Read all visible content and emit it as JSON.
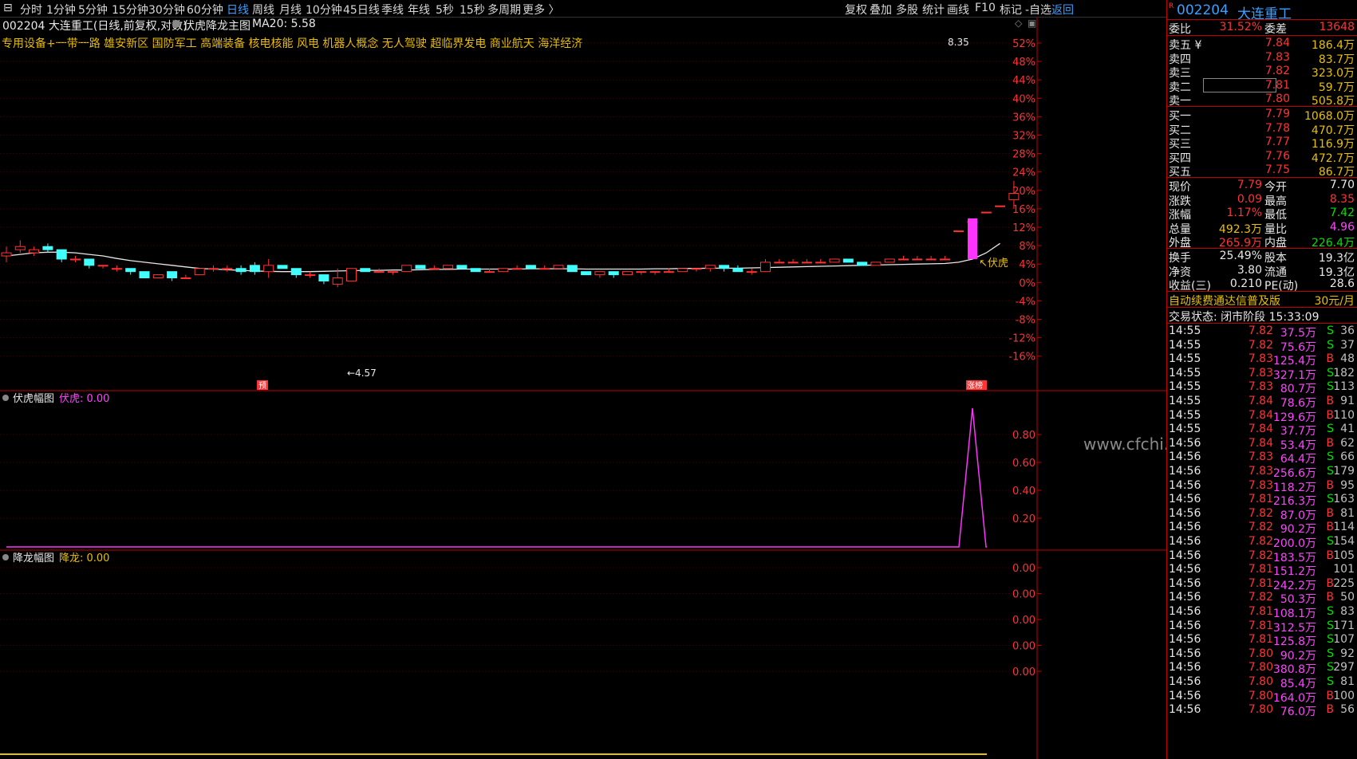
{
  "toolbar": {
    "periods": [
      "分时",
      "1分钟",
      "5分钟",
      "15分钟",
      "30分钟",
      "60分钟",
      "日线",
      "周线",
      "月线",
      "10分钟",
      "45日线",
      "季线",
      "年线",
      "5秒",
      "15秒",
      "多周期",
      "更多 〉"
    ],
    "active_period": "日线",
    "right_items": [
      "复权",
      "叠加",
      "多股",
      "统计",
      "画线",
      "F10",
      "标记",
      "-自选",
      "返回"
    ]
  },
  "header": {
    "stock": "002204 大连重工(日线,前复权,对数)",
    "indicator_name": "伏虎降龙主图",
    "ma_label": "MA20: 5.58"
  },
  "concepts": "专用设备+一带一路 雄安新区 国防军工 高端装备 核电核能 风电 机器人概念 无人驾驶 超临界发电 商业航天 海洋经济",
  "main_chart": {
    "y_axis_pct": [
      "52%",
      "48%",
      "44%",
      "40%",
      "36%",
      "32%",
      "28%",
      "24%",
      "20%",
      "16%",
      "12%",
      "8%",
      "4%",
      "0%",
      "-4%",
      "-8%",
      "-12%",
      "-16%"
    ],
    "high_label": "8.35",
    "low_label": "←4.57",
    "signal_label": "↖伏虎",
    "marker_left": "预",
    "marker_right": "涨榜",
    "colors": {
      "up": "#ff3333",
      "down": "#40ffff",
      "ma": "#e8e8e8",
      "signal": "#ff33ff"
    }
  },
  "panel2": {
    "title": "伏虎幅图",
    "value_label": "伏虎: 0.00",
    "y_axis": [
      "0.80",
      "0.60",
      "0.40",
      "0.20"
    ],
    "peak_value": 1.0
  },
  "panel3": {
    "title": "降龙幅图",
    "value_label": "降龙: 0.00",
    "y_axis": [
      "0.00",
      "0.00",
      "0.00",
      "0.00",
      "0.00"
    ]
  },
  "watermark": "www.cfchi.com",
  "quote": {
    "code": "002204",
    "name": "大连重工",
    "weibi_label": "委比",
    "weibi": "31.52%",
    "weicha_label": "委差",
    "weicha": "13648",
    "sell": [
      {
        "label": "卖五 ¥",
        "price": "7.84",
        "vol": "186.4万"
      },
      {
        "label": "卖四",
        "price": "7.83",
        "vol": "83.7万"
      },
      {
        "label": "卖三",
        "price": "7.82",
        "vol": "323.0万"
      },
      {
        "label": "卖二",
        "price": "7.81",
        "vol": "59.7万"
      },
      {
        "label": "卖一",
        "price": "7.80",
        "vol": "505.8万"
      }
    ],
    "buy": [
      {
        "label": "买一",
        "price": "7.79",
        "vol": "1068.0万"
      },
      {
        "label": "买二",
        "price": "7.78",
        "vol": "470.7万"
      },
      {
        "label": "买三",
        "price": "7.77",
        "vol": "116.9万"
      },
      {
        "label": "买四",
        "price": "7.76",
        "vol": "472.7万"
      },
      {
        "label": "买五",
        "price": "7.75",
        "vol": "86.7万"
      }
    ],
    "stats": [
      {
        "l1": "现价",
        "v1": "7.79",
        "c1": "red",
        "l2": "今开",
        "v2": "7.70",
        "c2": "white"
      },
      {
        "l1": "涨跌",
        "v1": "0.09",
        "c1": "red",
        "l2": "最高",
        "v2": "8.35",
        "c2": "red"
      },
      {
        "l1": "涨幅",
        "v1": "1.17%",
        "c1": "red",
        "l2": "最低",
        "v2": "7.42",
        "c2": "green"
      },
      {
        "l1": "总量",
        "v1": "492.3万",
        "c1": "yellow",
        "l2": "量比",
        "v2": "4.96",
        "c2": "magenta"
      },
      {
        "l1": "外盘",
        "v1": "265.9万",
        "c1": "red",
        "l2": "内盘",
        "v2": "226.4万",
        "c2": "green"
      }
    ],
    "stats2": [
      {
        "l1": "换手",
        "v1": "25.49%",
        "l2": "股本",
        "v2": "19.3亿"
      },
      {
        "l1": "净资",
        "v1": "3.80",
        "l2": "流通",
        "v2": "19.3亿"
      },
      {
        "l1": "收益(三)",
        "v1": "0.210",
        "l2": "PE(动)",
        "v2": "28.6"
      }
    ],
    "promo": "自动续费通达信普及版",
    "promo_price": "30元/月",
    "trade_status": "交易状态: 闭市阶段 15:33:09"
  },
  "ticks": [
    {
      "t": "14:55",
      "p": "7.82",
      "v": "37.5万",
      "s": "S",
      "n": "36"
    },
    {
      "t": "14:55",
      "p": "7.82",
      "v": "75.6万",
      "s": "S",
      "n": "37"
    },
    {
      "t": "14:55",
      "p": "7.83",
      "v": "125.4万",
      "s": "B",
      "n": "48"
    },
    {
      "t": "14:55",
      "p": "7.83",
      "v": "327.1万",
      "s": "S",
      "n": "182"
    },
    {
      "t": "14:55",
      "p": "7.83",
      "v": "80.7万",
      "s": "S",
      "n": "113"
    },
    {
      "t": "14:55",
      "p": "7.84",
      "v": "78.6万",
      "s": "B",
      "n": "91"
    },
    {
      "t": "14:55",
      "p": "7.84",
      "v": "129.6万",
      "s": "B",
      "n": "110"
    },
    {
      "t": "14:55",
      "p": "7.84",
      "v": "37.7万",
      "s": "S",
      "n": "41"
    },
    {
      "t": "14:56",
      "p": "7.84",
      "v": "53.4万",
      "s": "B",
      "n": "62"
    },
    {
      "t": "14:56",
      "p": "7.83",
      "v": "64.4万",
      "s": "S",
      "n": "66"
    },
    {
      "t": "14:56",
      "p": "7.83",
      "v": "256.6万",
      "s": "S",
      "n": "179"
    },
    {
      "t": "14:56",
      "p": "7.83",
      "v": "118.2万",
      "s": "B",
      "n": "95"
    },
    {
      "t": "14:56",
      "p": "7.81",
      "v": "216.3万",
      "s": "S",
      "n": "163"
    },
    {
      "t": "14:56",
      "p": "7.82",
      "v": "87.0万",
      "s": "B",
      "n": "81"
    },
    {
      "t": "14:56",
      "p": "7.82",
      "v": "90.2万",
      "s": "B",
      "n": "114"
    },
    {
      "t": "14:56",
      "p": "7.82",
      "v": "200.0万",
      "s": "S",
      "n": "154"
    },
    {
      "t": "14:56",
      "p": "7.82",
      "v": "183.5万",
      "s": "B",
      "n": "105"
    },
    {
      "t": "14:56",
      "p": "7.81",
      "v": "151.2万",
      "s": "",
      "n": "101"
    },
    {
      "t": "14:56",
      "p": "7.81",
      "v": "242.2万",
      "s": "B",
      "n": "225"
    },
    {
      "t": "14:56",
      "p": "7.82",
      "v": "50.3万",
      "s": "B",
      "n": "50"
    },
    {
      "t": "14:56",
      "p": "7.81",
      "v": "108.1万",
      "s": "S",
      "n": "83"
    },
    {
      "t": "14:56",
      "p": "7.81",
      "v": "312.5万",
      "s": "S",
      "n": "171"
    },
    {
      "t": "14:56",
      "p": "7.81",
      "v": "125.8万",
      "s": "S",
      "n": "107"
    },
    {
      "t": "14:56",
      "p": "7.80",
      "v": "90.2万",
      "s": "S",
      "n": "92"
    },
    {
      "t": "14:56",
      "p": "7.80",
      "v": "380.8万",
      "s": "S",
      "n": "297"
    },
    {
      "t": "14:56",
      "p": "7.80",
      "v": "85.4万",
      "s": "S",
      "n": "81"
    },
    {
      "t": "14:56",
      "p": "7.80",
      "v": "164.0万",
      "s": "B",
      "n": "100"
    },
    {
      "t": "14:56",
      "p": "7.80",
      "v": "76.0万",
      "s": "B",
      "n": "56"
    }
  ],
  "candles": [
    {
      "o": 0.32,
      "c": 0.33,
      "h": 0.35,
      "l": 0.3
    },
    {
      "o": 0.34,
      "c": 0.35,
      "h": 0.37,
      "l": 0.33
    },
    {
      "o": 0.33,
      "c": 0.34,
      "h": 0.35,
      "l": 0.32
    },
    {
      "o": 0.35,
      "c": 0.34,
      "h": 0.36,
      "l": 0.33
    },
    {
      "o": 0.34,
      "c": 0.31,
      "h": 0.34,
      "l": 0.3
    },
    {
      "o": 0.31,
      "c": 0.31,
      "h": 0.32,
      "l": 0.3
    },
    {
      "o": 0.31,
      "c": 0.29,
      "h": 0.31,
      "l": 0.28
    },
    {
      "o": 0.29,
      "c": 0.29,
      "h": 0.29,
      "l": 0.28
    },
    {
      "o": 0.28,
      "c": 0.28,
      "h": 0.29,
      "l": 0.27
    },
    {
      "o": 0.28,
      "c": 0.27,
      "h": 0.28,
      "l": 0.26
    },
    {
      "o": 0.27,
      "c": 0.25,
      "h": 0.27,
      "l": 0.25
    },
    {
      "o": 0.25,
      "c": 0.26,
      "h": 0.26,
      "l": 0.25
    },
    {
      "o": 0.27,
      "c": 0.25,
      "h": 0.27,
      "l": 0.24
    },
    {
      "o": 0.25,
      "c": 0.25,
      "h": 0.26,
      "l": 0.25
    },
    {
      "o": 0.26,
      "c": 0.28,
      "h": 0.28,
      "l": 0.26
    },
    {
      "o": 0.28,
      "c": 0.28,
      "h": 0.29,
      "l": 0.27
    },
    {
      "o": 0.28,
      "c": 0.28,
      "h": 0.29,
      "l": 0.27
    },
    {
      "o": 0.28,
      "c": 0.27,
      "h": 0.29,
      "l": 0.26
    },
    {
      "o": 0.29,
      "c": 0.27,
      "h": 0.3,
      "l": 0.26
    },
    {
      "o": 0.27,
      "c": 0.29,
      "h": 0.31,
      "l": 0.25
    },
    {
      "o": 0.29,
      "c": 0.28,
      "h": 0.29,
      "l": 0.28
    },
    {
      "o": 0.28,
      "c": 0.26,
      "h": 0.28,
      "l": 0.25
    },
    {
      "o": 0.26,
      "c": 0.26,
      "h": 0.27,
      "l": 0.25
    },
    {
      "o": 0.26,
      "c": 0.24,
      "h": 0.26,
      "l": 0.23
    },
    {
      "o": 0.23,
      "c": 0.25,
      "h": 0.28,
      "l": 0.22
    },
    {
      "o": 0.24,
      "c": 0.28,
      "h": 0.28,
      "l": 0.24
    },
    {
      "o": 0.28,
      "c": 0.27,
      "h": 0.28,
      "l": 0.27
    },
    {
      "o": 0.27,
      "c": 0.27,
      "h": 0.28,
      "l": 0.27
    },
    {
      "o": 0.27,
      "c": 0.27,
      "h": 0.27,
      "l": 0.26
    },
    {
      "o": 0.27,
      "c": 0.29,
      "h": 0.29,
      "l": 0.27
    },
    {
      "o": 0.29,
      "c": 0.28,
      "h": 0.29,
      "l": 0.28
    },
    {
      "o": 0.28,
      "c": 0.28,
      "h": 0.29,
      "l": 0.28
    },
    {
      "o": 0.28,
      "c": 0.29,
      "h": 0.29,
      "l": 0.28
    },
    {
      "o": 0.29,
      "c": 0.28,
      "h": 0.29,
      "l": 0.28
    },
    {
      "o": 0.28,
      "c": 0.27,
      "h": 0.28,
      "l": 0.27
    },
    {
      "o": 0.27,
      "c": 0.27,
      "h": 0.28,
      "l": 0.27
    },
    {
      "o": 0.27,
      "c": 0.28,
      "h": 0.28,
      "l": 0.27
    },
    {
      "o": 0.28,
      "c": 0.28,
      "h": 0.29,
      "l": 0.28
    },
    {
      "o": 0.29,
      "c": 0.28,
      "h": 0.29,
      "l": 0.28
    },
    {
      "o": 0.28,
      "c": 0.28,
      "h": 0.29,
      "l": 0.28
    },
    {
      "o": 0.28,
      "c": 0.29,
      "h": 0.29,
      "l": 0.28
    },
    {
      "o": 0.29,
      "c": 0.27,
      "h": 0.29,
      "l": 0.27
    },
    {
      "o": 0.27,
      "c": 0.26,
      "h": 0.27,
      "l": 0.26
    },
    {
      "o": 0.26,
      "c": 0.27,
      "h": 0.27,
      "l": 0.25
    },
    {
      "o": 0.27,
      "c": 0.26,
      "h": 0.27,
      "l": 0.25
    },
    {
      "o": 0.26,
      "c": 0.27,
      "h": 0.27,
      "l": 0.26
    },
    {
      "o": 0.27,
      "c": 0.27,
      "h": 0.27,
      "l": 0.26
    },
    {
      "o": 0.27,
      "c": 0.27,
      "h": 0.27,
      "l": 0.26
    },
    {
      "o": 0.27,
      "c": 0.27,
      "h": 0.28,
      "l": 0.27
    },
    {
      "o": 0.27,
      "c": 0.28,
      "h": 0.28,
      "l": 0.27
    },
    {
      "o": 0.28,
      "c": 0.28,
      "h": 0.28,
      "l": 0.27
    },
    {
      "o": 0.28,
      "c": 0.29,
      "h": 0.29,
      "l": 0.27
    },
    {
      "o": 0.29,
      "c": 0.28,
      "h": 0.29,
      "l": 0.27
    },
    {
      "o": 0.28,
      "c": 0.27,
      "h": 0.29,
      "l": 0.27
    },
    {
      "o": 0.27,
      "c": 0.27,
      "h": 0.28,
      "l": 0.26
    },
    {
      "o": 0.27,
      "c": 0.3,
      "h": 0.31,
      "l": 0.27
    },
    {
      "o": 0.3,
      "c": 0.3,
      "h": 0.31,
      "l": 0.3
    },
    {
      "o": 0.3,
      "c": 0.3,
      "h": 0.31,
      "l": 0.3
    },
    {
      "o": 0.3,
      "c": 0.3,
      "h": 0.31,
      "l": 0.3
    },
    {
      "o": 0.3,
      "c": 0.3,
      "h": 0.31,
      "l": 0.3
    },
    {
      "o": 0.3,
      "c": 0.31,
      "h": 0.31,
      "l": 0.3
    },
    {
      "o": 0.31,
      "c": 0.3,
      "h": 0.31,
      "l": 0.3
    },
    {
      "o": 0.3,
      "c": 0.29,
      "h": 0.3,
      "l": 0.29
    },
    {
      "o": 0.29,
      "c": 0.3,
      "h": 0.3,
      "l": 0.29
    },
    {
      "o": 0.3,
      "c": 0.31,
      "h": 0.31,
      "l": 0.3
    },
    {
      "o": 0.31,
      "c": 0.31,
      "h": 0.32,
      "l": 0.31
    },
    {
      "o": 0.31,
      "c": 0.31,
      "h": 0.32,
      "l": 0.31
    },
    {
      "o": 0.31,
      "c": 0.31,
      "h": 0.32,
      "l": 0.31
    },
    {
      "o": 0.31,
      "c": 0.31,
      "h": 0.32,
      "l": 0.31
    },
    {
      "o": 0.4,
      "c": 0.4,
      "h": 0.4,
      "l": 0.4
    },
    {
      "o": 0.43,
      "c": 0.43,
      "h": 0.43,
      "l": 0.43
    },
    {
      "o": 0.46,
      "c": 0.46,
      "h": 0.46,
      "l": 0.46
    },
    {
      "o": 0.48,
      "c": 0.48,
      "h": 0.48,
      "l": 0.48
    },
    {
      "o": 0.5,
      "c": 0.52,
      "h": 0.56,
      "l": 0.47
    }
  ],
  "ma": [
    0.32,
    0.325,
    0.33,
    0.332,
    0.332,
    0.33,
    0.325,
    0.32,
    0.312,
    0.305,
    0.3,
    0.295,
    0.29,
    0.285,
    0.28,
    0.278,
    0.276,
    0.274,
    0.272,
    0.271,
    0.27,
    0.27,
    0.27,
    0.271,
    0.272,
    0.273,
    0.274,
    0.274,
    0.275,
    0.275,
    0.276,
    0.277,
    0.277,
    0.278,
    0.278,
    0.278,
    0.278,
    0.278,
    0.279,
    0.279,
    0.279,
    0.279,
    0.278,
    0.278,
    0.278,
    0.278,
    0.278,
    0.279,
    0.279,
    0.28,
    0.28,
    0.281,
    0.281,
    0.281,
    0.282,
    0.283,
    0.284,
    0.285,
    0.286,
    0.287,
    0.288,
    0.289,
    0.29,
    0.291,
    0.292,
    0.293,
    0.294,
    0.295,
    0.296,
    0.3,
    0.31,
    0.33,
    0.36
  ]
}
